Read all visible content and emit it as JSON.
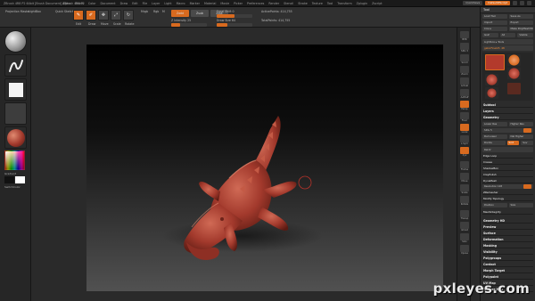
{
  "title_bar": {
    "title": "ZBrush 4R8 P2 64bit [Brush Document]  ZBrush 4R8 P2",
    "menus": [
      "Alpha",
      "Brush",
      "Color",
      "Document",
      "Draw",
      "Edit",
      "File",
      "Layer",
      "Light",
      "Macro",
      "Marker",
      "Material",
      "Movie",
      "Picker",
      "Preferences",
      "Render",
      "Stencil",
      "Stroke",
      "Texture",
      "Tool",
      "Transform",
      "Zplugin",
      "Zscript"
    ],
    "quicksave_label": "QuickSave",
    "layout_label": "DefaultZScript"
  },
  "toolbar": {
    "projection_master": "Projection Master",
    "lightbox": "LightBox",
    "quick_sketch": "Quick Sketch",
    "edit_label": "Edit",
    "draw_label": "Draw",
    "move_label": "Move",
    "scale_label": "Scale",
    "rotate_label": "Rotate",
    "mrgb_label": "Mrgb",
    "rgb_label": "Rgb",
    "m_label": "M",
    "zadd_label": "Zadd",
    "zsub_label": "Zsub",
    "zcut_label": "Zcut",
    "focal_shift_label": "Focal Shift 0",
    "draw_size_label": "Draw Size 64",
    "z_intensity_label": "Z Intensity 25",
    "rgb_intensity_label": "Rgb Intensity 100",
    "active_points_label": "ActivePoints: 414,755",
    "total_points_label": "TotalPoints: 414,755"
  },
  "left_shelf": {
    "gradient_label": "Gradient",
    "switch_color_label": "SwitchColor"
  },
  "right_shelf": {
    "labels": [
      "BPR",
      "SPix 3",
      "Scroll",
      "Zoom",
      "Actual",
      "AAHalf",
      "Persp",
      "Floor",
      "Local",
      "L.Sym",
      "Xyz",
      "Frame",
      "Move",
      "Scale",
      "Rotate",
      "Transp",
      "Ghost",
      "Solo",
      "Xpose"
    ]
  },
  "tool_panel": {
    "header": "Tool",
    "row1": [
      "Load Tool",
      "Save As"
    ],
    "row2": [
      "Import",
      "Export"
    ],
    "row3": [
      "Clone",
      "Make PolyMesh3D"
    ],
    "row4": [
      "GoZ",
      "All",
      "Visible"
    ],
    "lightbox_tools": "Lightbox ▸ Tools",
    "current_tool": "gatorFinal23. 48",
    "sections": [
      "Subtool",
      "Layers",
      "Geometry"
    ],
    "geometry": {
      "lower_res": "Lower Res",
      "higher_res": "Higher Res",
      "sdiv": "SDiv 5",
      "del_lower": "Del Lower",
      "del_higher": "Del Higher",
      "divide": "Divide",
      "smt": "Smt",
      "suv": "Suv",
      "reuv": "ReUV",
      "edge_loop": "Edge Loop",
      "crease": "Crease",
      "shadowbox": "ShadowBox",
      "claypolish": "ClayPolish",
      "dynamesh": "DynaMesh",
      "resolution": "Resolution 128",
      "zremesher": "ZRemesher",
      "modify_topology": "Modify Topology",
      "position": "Position",
      "size": "Size",
      "meshintegrity": "MeshIntegrity"
    },
    "lower_sections": [
      "Geometry HD",
      "Preview",
      "Surface",
      "Deformation",
      "Masking",
      "Visibility",
      "Polygroups",
      "Contact",
      "Morph Target",
      "Polypaint",
      "UV Map",
      "Texture Map"
    ]
  },
  "watermark": "pxleyes.com",
  "colors": {
    "accent": "#d86a1f",
    "clay": "#a2392c",
    "panel_bg": "#2c2c2c"
  },
  "icons": {
    "brush_sphere": "sphere-brush-icon",
    "stroke": "stroke-icon",
    "alpha": "alpha-square-icon",
    "texture": "texture-off-icon",
    "material": "clay-material-icon",
    "color_picker": "color-picker-icon"
  }
}
